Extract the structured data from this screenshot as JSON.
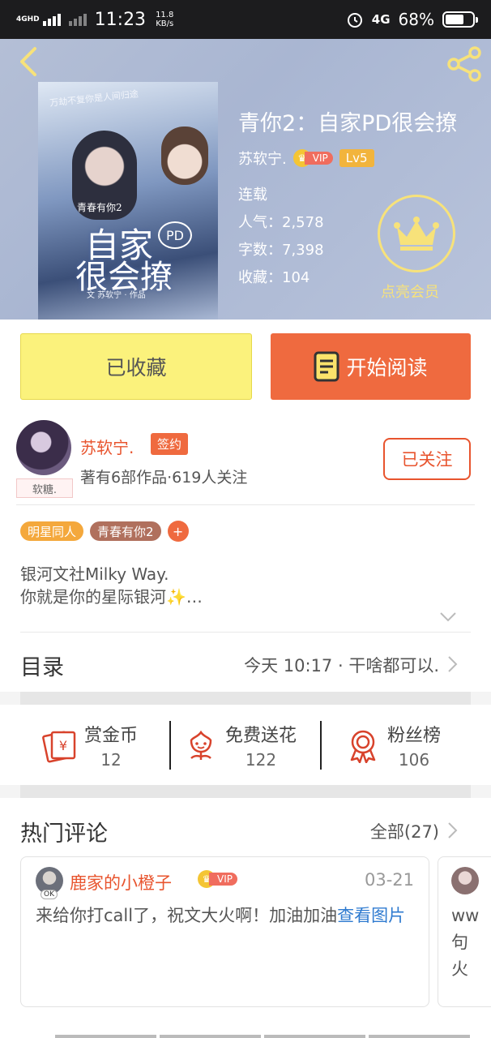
{
  "status_bar": {
    "network": "4GHD",
    "time": "11:23",
    "speed": "11.8",
    "speed_unit": "KB/s",
    "net_right": "4G",
    "battery": "68%",
    "battery_level": 0.68
  },
  "book": {
    "title": "青你2：自家PD很会撩",
    "author": "苏软宁.",
    "vip": "VIP",
    "level": "Lv5",
    "status": "连载",
    "popularity": "人气：2,578",
    "words": "字数：7,398",
    "favorites": "收藏：104",
    "member_label": "点亮会员",
    "cover": {
      "tagline": "万劫不复你是人间归途",
      "subtitle": "青春有你2",
      "big_line1": "自家",
      "pd": "PD",
      "big_line2": "很会撩",
      "byline": "文 苏软宁 · 作品"
    }
  },
  "actions": {
    "collect": "已收藏",
    "read": "开始阅读"
  },
  "author": {
    "name": "苏软宁.",
    "signed": "签约",
    "works": "著有6部作品·619人关注",
    "follow": "已关注",
    "avatar_tag": "软糖."
  },
  "tags": [
    "明星同人",
    "青春有你2",
    "+"
  ],
  "intro": {
    "line1": "银河文社Milky Way.",
    "line2": "你就是你的星际银河✨…"
  },
  "toc": {
    "label": "目录",
    "latest": "今天 10:17 · 干啥都可以."
  },
  "stats": [
    {
      "name": "赏金币",
      "value": "12",
      "icon": "coin-envelope-icon"
    },
    {
      "name": "免费送花",
      "value": "122",
      "icon": "flower-icon"
    },
    {
      "name": "粉丝榜",
      "value": "106",
      "icon": "medal-icon"
    }
  ],
  "comments": {
    "heading": "热门评论",
    "all": "全部(27)",
    "items": [
      {
        "user": "鹿家的小橙子",
        "vip": "VIP",
        "avatar_tag": "OK",
        "date": "03-21",
        "text": "来给你打call了，祝文大火啊！加油加油",
        "link": "查看图片"
      },
      {
        "text": "ww\n句\n火"
      }
    ]
  },
  "colors": {
    "accent": "#ef6a3f",
    "collect_bg": "#fbf27c",
    "link": "#2f7bd0",
    "member": "#f7e27a"
  }
}
